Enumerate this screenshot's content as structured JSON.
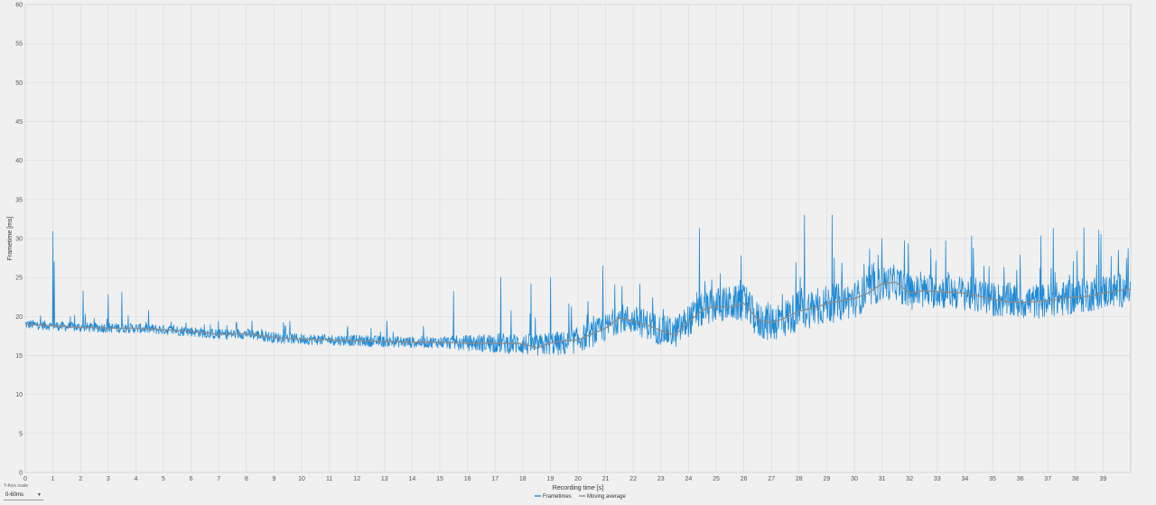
{
  "chart_data": {
    "type": "line",
    "xlabel": "Recording time [s]",
    "ylabel": "Frametime [ms]",
    "xlim": [
      0,
      40
    ],
    "ylim": [
      0,
      60
    ],
    "x_ticks": [
      0,
      1,
      2,
      3,
      4,
      5,
      6,
      7,
      8,
      9,
      10,
      11,
      12,
      13,
      14,
      15,
      16,
      17,
      18,
      19,
      20,
      21,
      22,
      23,
      24,
      25,
      26,
      27,
      28,
      29,
      30,
      31,
      32,
      33,
      34,
      35,
      36,
      37,
      38,
      39
    ],
    "y_ticks": [
      0,
      5,
      10,
      15,
      20,
      25,
      30,
      35,
      40,
      45,
      50,
      55,
      60
    ],
    "grid": true,
    "legend_position": "bottom-center",
    "series": [
      {
        "name": "Frametimes",
        "color": "#1f8ad6",
        "trend": [
          [
            0,
            19.0
          ],
          [
            2,
            18.6
          ],
          [
            4,
            18.5
          ],
          [
            6,
            18.1
          ],
          [
            7,
            17.7
          ],
          [
            8,
            17.8
          ],
          [
            9,
            17.3
          ],
          [
            10,
            17.1
          ],
          [
            11,
            17.0
          ],
          [
            12,
            16.9
          ],
          [
            13,
            16.8
          ],
          [
            14,
            16.7
          ],
          [
            15,
            16.7
          ],
          [
            16,
            16.6
          ],
          [
            17,
            16.6
          ],
          [
            18,
            16.5
          ],
          [
            18.5,
            16.2
          ],
          [
            19,
            16.6
          ],
          [
            19.5,
            16.5
          ],
          [
            20,
            17.0
          ],
          [
            21,
            18.5
          ],
          [
            21.5,
            19.8
          ],
          [
            22,
            19.5
          ],
          [
            22.5,
            19.0
          ],
          [
            23,
            18.2
          ],
          [
            23.5,
            17.9
          ],
          [
            24,
            19.5
          ],
          [
            24.5,
            20.8
          ],
          [
            25,
            21.5
          ],
          [
            26,
            21.7
          ],
          [
            26.5,
            19.5
          ],
          [
            27,
            19.3
          ],
          [
            27.5,
            19.8
          ],
          [
            28,
            20.8
          ],
          [
            29,
            21.5
          ],
          [
            30,
            22.2
          ],
          [
            31,
            24.2
          ],
          [
            31.5,
            24.4
          ],
          [
            32,
            23.1
          ],
          [
            33,
            23.3
          ],
          [
            34,
            23.0
          ],
          [
            35,
            22.2
          ],
          [
            36,
            21.9
          ],
          [
            37,
            22.0
          ],
          [
            38,
            22.5
          ],
          [
            39,
            23.2
          ],
          [
            40,
            23.5
          ]
        ],
        "noise_amplitude": [
          [
            0,
            0.8
          ],
          [
            15,
            1.0
          ],
          [
            17,
            1.7
          ],
          [
            20,
            2.2
          ],
          [
            24,
            2.8
          ],
          [
            28,
            3.5
          ],
          [
            31,
            3.0
          ],
          [
            40,
            3.0
          ]
        ],
        "spikes": [
          [
            1.0,
            30.9
          ],
          [
            1.05,
            27.0
          ],
          [
            2.1,
            23.3
          ],
          [
            3.0,
            22.8
          ],
          [
            3.5,
            23.1
          ],
          [
            15.5,
            23.2
          ],
          [
            17.2,
            25.0
          ],
          [
            18.3,
            24.2
          ],
          [
            19.0,
            25.0
          ],
          [
            20.9,
            26.5
          ],
          [
            24.4,
            31.3
          ],
          [
            25.9,
            27.8
          ],
          [
            28.2,
            33.0
          ],
          [
            29.2,
            33.0
          ],
          [
            31.0,
            30.0
          ],
          [
            33.3,
            29.7
          ],
          [
            34.3,
            28.8
          ],
          [
            37.2,
            31.3
          ],
          [
            38.3,
            31.4
          ],
          [
            39.9,
            28.7
          ]
        ]
      },
      {
        "name": "Moving average",
        "color": "#8c8c8c",
        "points": [
          [
            0,
            19.0
          ],
          [
            1,
            18.8
          ],
          [
            2,
            18.6
          ],
          [
            3,
            18.5
          ],
          [
            4,
            18.5
          ],
          [
            5,
            18.3
          ],
          [
            6,
            18.1
          ],
          [
            7,
            17.7
          ],
          [
            8,
            17.8
          ],
          [
            9,
            17.3
          ],
          [
            10,
            17.1
          ],
          [
            11,
            17.0
          ],
          [
            12,
            16.9
          ],
          [
            13,
            16.8
          ],
          [
            14,
            16.7
          ],
          [
            15,
            16.7
          ],
          [
            16,
            16.6
          ],
          [
            17,
            16.6
          ],
          [
            18,
            16.5
          ],
          [
            18.5,
            16.0
          ],
          [
            19,
            16.6
          ],
          [
            19.5,
            16.9
          ],
          [
            20,
            17.0
          ],
          [
            21,
            18.5
          ],
          [
            21.5,
            19.8
          ],
          [
            22,
            19.4
          ],
          [
            22.5,
            18.9
          ],
          [
            23,
            18.2
          ],
          [
            23.5,
            17.6
          ],
          [
            24,
            19.3
          ],
          [
            24.5,
            20.8
          ],
          [
            25,
            21.3
          ],
          [
            25.5,
            21.2
          ],
          [
            26,
            21.7
          ],
          [
            26.5,
            19.6
          ],
          [
            27,
            19.2
          ],
          [
            27.5,
            19.8
          ],
          [
            28,
            20.7
          ],
          [
            28.5,
            21.1
          ],
          [
            29,
            21.6
          ],
          [
            29.5,
            22.0
          ],
          [
            30,
            22.3
          ],
          [
            30.5,
            23.0
          ],
          [
            31,
            24.2
          ],
          [
            31.5,
            24.4
          ],
          [
            32,
            23.0
          ],
          [
            32.5,
            23.3
          ],
          [
            33,
            23.2
          ],
          [
            33.5,
            23.1
          ],
          [
            34,
            23.0
          ],
          [
            34.5,
            22.6
          ],
          [
            35,
            22.2
          ],
          [
            35.5,
            21.9
          ],
          [
            36,
            21.8
          ],
          [
            36.5,
            21.9
          ],
          [
            37,
            22.0
          ],
          [
            37.5,
            22.3
          ],
          [
            38,
            22.5
          ],
          [
            38.5,
            22.6
          ],
          [
            39,
            23.0
          ],
          [
            39.5,
            23.3
          ],
          [
            40,
            23.5
          ]
        ]
      }
    ]
  },
  "controls": {
    "scale_caption": "Y-Axis scale",
    "scale_value": "0-60ms"
  }
}
